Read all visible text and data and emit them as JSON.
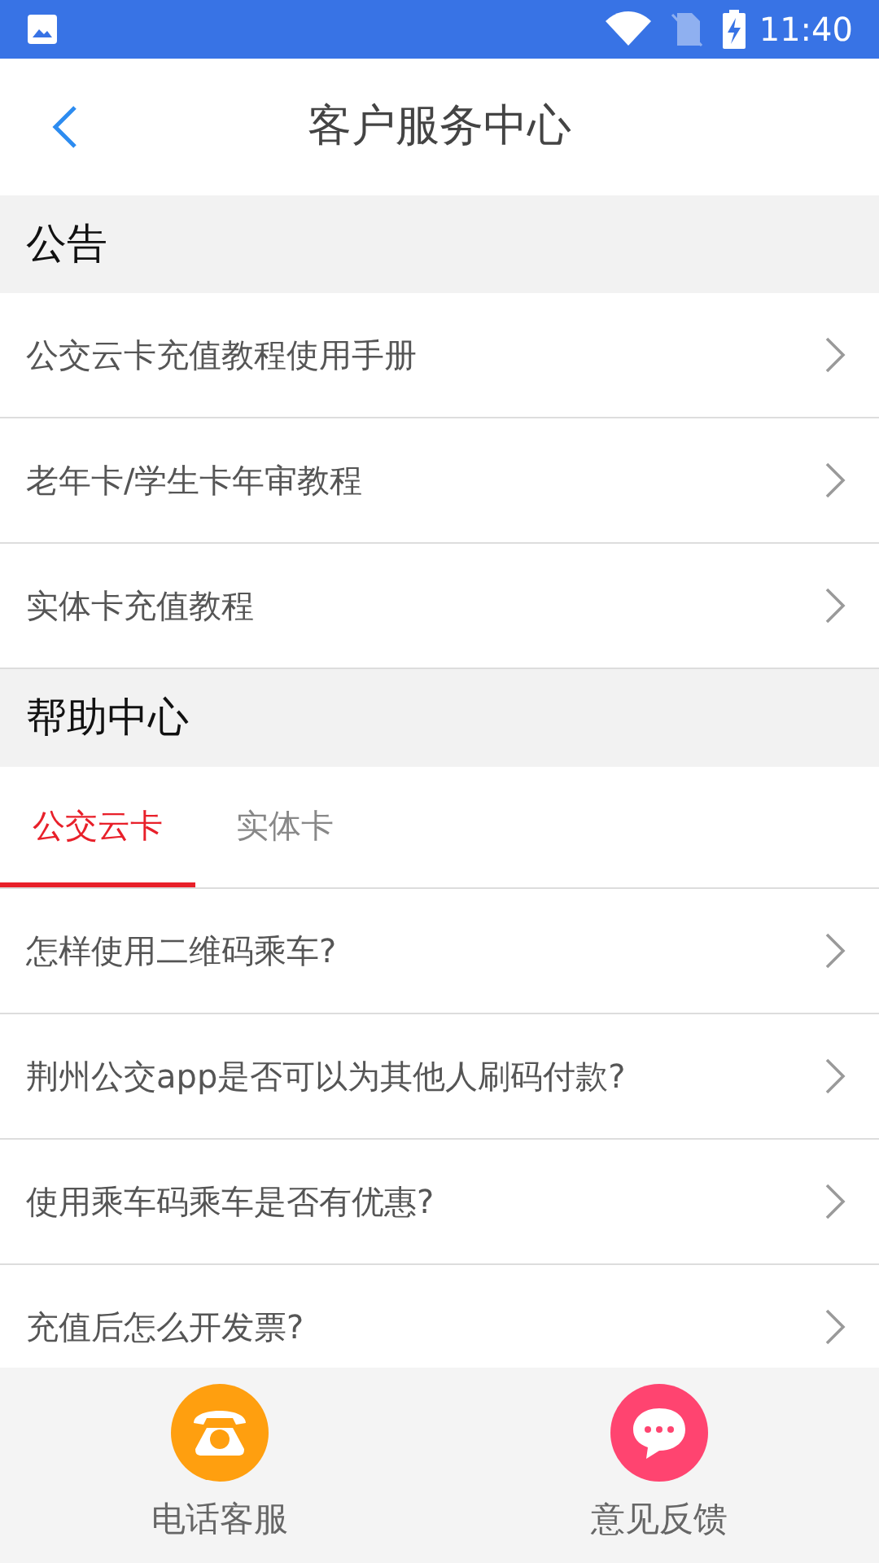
{
  "status_bar": {
    "time": "11:40"
  },
  "header": {
    "title": "客户服务中心"
  },
  "notice": {
    "title": "公告",
    "items": [
      "公交云卡充值教程使用手册",
      "老年卡/学生卡年审教程",
      "实体卡充值教程"
    ]
  },
  "help": {
    "title": "帮助中心",
    "tabs": [
      {
        "label": "公交云卡",
        "selected": true
      },
      {
        "label": "实体卡",
        "selected": false
      }
    ],
    "items": [
      "怎样使用二维码乘车?",
      "荆州公交app是否可以为其他人刷码付款?",
      "使用乘车码乘车是否有优惠?",
      "充值后怎么开发票?"
    ]
  },
  "bottom_actions": [
    {
      "label": "电话客服",
      "kind": "phone",
      "color": "#ff9f0f"
    },
    {
      "label": "意见反馈",
      "kind": "chat",
      "color": "#ff4470"
    }
  ]
}
